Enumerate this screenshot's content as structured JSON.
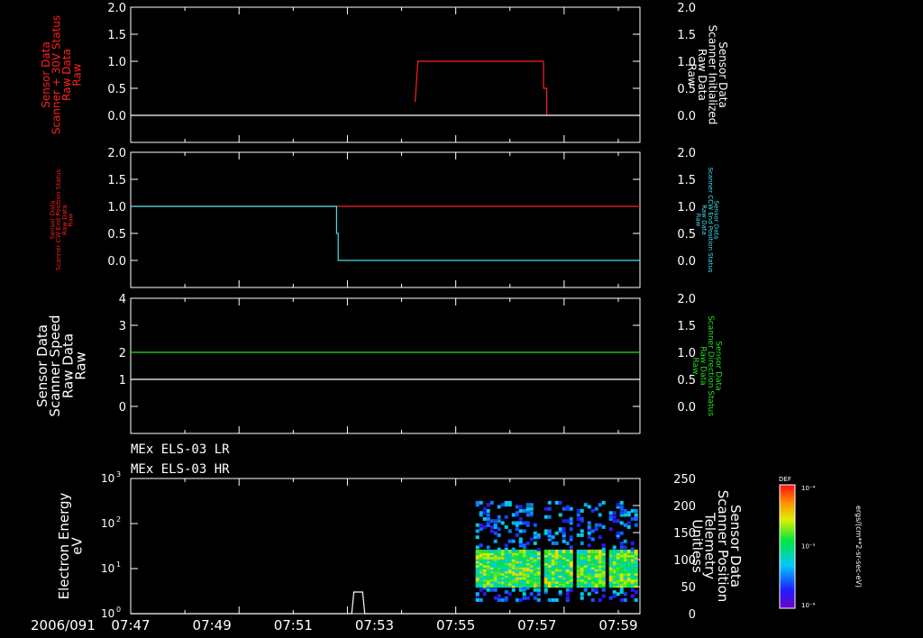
{
  "colors": {
    "background": "#000000",
    "foreground": "#ffffff",
    "red": "#ff2020",
    "cyan": "#40e0f0",
    "green": "#20e020"
  },
  "time_axis": {
    "date_label": "2006/091",
    "ticks": [
      "07:47",
      "07:49",
      "07:51",
      "07:53",
      "07:55",
      "07:57",
      "07:59"
    ]
  },
  "chart_data": [
    {
      "type": "line",
      "panel": 1,
      "left_axis": {
        "label_lines": [
          "Sensor Data",
          "Scanner + 30V Status",
          "Raw Data",
          "Raw"
        ],
        "color": "#ff2020",
        "ylim": [
          -0.5,
          2.0
        ],
        "ticks": [
          "2.0",
          "1.5",
          "1.0",
          "0.5",
          "0.0"
        ]
      },
      "right_axis": {
        "label_lines": [
          "Sensor Data",
          "Scanner Initialized",
          "Raw Data",
          "Raw"
        ],
        "color": "#ffffff",
        "ylim": [
          -0.5,
          2.0
        ],
        "ticks": [
          "2.0",
          "1.5",
          "1.0",
          "0.5",
          "0.0"
        ]
      },
      "series": [
        {
          "color": "#ff2020",
          "x_minutes": [
            0,
            5.25,
            5.25,
            5.3,
            5.3,
            7.62,
            7.62,
            7.68,
            7.68,
            9.4
          ],
          "y": [
            null,
            null,
            0.25,
            1.0,
            1.0,
            1.0,
            0.5,
            0.5,
            0.0,
            null
          ]
        },
        {
          "color": "#ffffff",
          "x_minutes": [
            0,
            9.4
          ],
          "y": [
            0.0,
            0.0
          ]
        }
      ]
    },
    {
      "type": "line",
      "panel": 2,
      "left_axis": {
        "label_lines": [
          "Sensor Data",
          "Scanner CW End Position Status",
          "Raw Data",
          "Raw"
        ],
        "color": "#ff2020",
        "ylim": [
          -0.5,
          2.0
        ],
        "ticks": [
          "2.0",
          "1.5",
          "1.0",
          "0.5",
          "0.0"
        ]
      },
      "right_axis": {
        "label_lines": [
          "Sensor Data",
          "Scanner CCW End Position Status",
          "Raw Data",
          "Raw"
        ],
        "color": "#40e0f0",
        "ylim": [
          -0.5,
          2.0
        ],
        "ticks": [
          "2.0",
          "1.5",
          "1.0",
          "0.5",
          "0.0"
        ]
      },
      "series": [
        {
          "color": "#ff2020",
          "x_minutes": [
            0,
            9.4
          ],
          "y": [
            1.0,
            1.0
          ]
        },
        {
          "color": "#40e0f0",
          "x_minutes": [
            0,
            3.8,
            3.8,
            3.83,
            3.83,
            9.4
          ],
          "y": [
            1.0,
            1.0,
            0.5,
            0.5,
            0.0,
            0.0
          ]
        }
      ]
    },
    {
      "type": "line",
      "panel": 3,
      "left_axis": {
        "label_lines": [
          "Sensor Data",
          "Scanner Speed",
          "Raw Data",
          "Raw"
        ],
        "color": "#ffffff",
        "ylim": [
          -1,
          4
        ],
        "ticks": [
          "4",
          "3",
          "2",
          "1",
          "0"
        ]
      },
      "right_axis": {
        "label_lines": [
          "Sensor Data",
          "Scanner Direction Status",
          "Raw Data",
          "Raw"
        ],
        "color": "#20e020",
        "ylim": [
          -0.5,
          2.0
        ],
        "ticks": [
          "2.0",
          "1.5",
          "1.0",
          "0.5",
          "0.0"
        ]
      },
      "series": [
        {
          "color": "#20e020",
          "x_minutes": [
            0,
            9.4
          ],
          "y": [
            1.0,
            1.0
          ]
        },
        {
          "color": "#ffffff",
          "x_minutes": [
            0,
            9.4
          ],
          "y": [
            0.5,
            0.5
          ]
        }
      ]
    },
    {
      "type": "heatmap",
      "panel": 4,
      "titles": [
        "MEx ELS-03 LR",
        "MEx ELS-03 HR"
      ],
      "left_axis": {
        "label_lines": [
          "Electron Energy",
          "eV"
        ],
        "scale": "log",
        "ylim": [
          1,
          1000
        ],
        "tick_bases": [
          "10",
          "10",
          "10",
          "10"
        ],
        "tick_exps": [
          "0",
          "1",
          "2",
          "3"
        ]
      },
      "right_axis": {
        "label_lines": [
          "Sensor Data",
          "Scanner Position",
          "Telemetry",
          "Unitless"
        ],
        "ylim": [
          0,
          250
        ],
        "ticks": [
          "250",
          "200",
          "150",
          "100",
          "50",
          "0"
        ]
      },
      "spectrogram": {
        "x_start_minutes": 6.3,
        "x_end_minutes": 9.4,
        "core_energy_eV": [
          4,
          25
        ],
        "scatter_energy_eV": [
          2,
          300
        ]
      },
      "position_line": {
        "color": "#ffffff",
        "x_minutes": [
          0,
          4.08,
          4.12,
          4.28,
          4.32,
          9.4
        ],
        "y": [
          0,
          0,
          40,
          40,
          0,
          0
        ]
      },
      "colorbar": {
        "title": "DEF",
        "unit": "ergs/(cm**2-sr-sec-eV)",
        "top_label": "10⁻⁴",
        "mid_label": "10⁻⁵",
        "bottom_label": "10⁻⁶"
      }
    }
  ]
}
